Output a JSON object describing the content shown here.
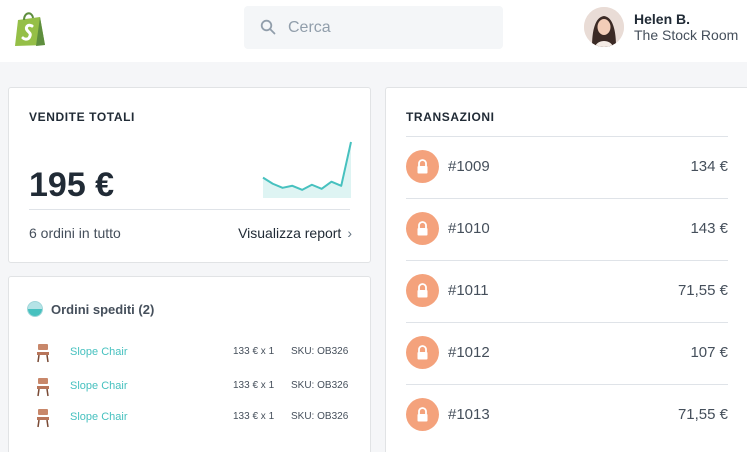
{
  "topbar": {
    "logo": "shopify-bag-logo",
    "search": {
      "placeholder": "Cerca",
      "icon": "search-icon"
    },
    "user": {
      "name": "Helen B.",
      "store": "The Stock Room"
    }
  },
  "sales_card": {
    "title": "VENDITE TOTALI",
    "total": "195 €",
    "orders_count": "6 ordini in tutto",
    "report_link": "Visualizza report",
    "sparkline_values": [
      20,
      14,
      10,
      12,
      8,
      13,
      9,
      16,
      12,
      55
    ],
    "accent_color": "#47c1bf"
  },
  "orders_card": {
    "title": "Ordini spediti (2)",
    "rows": [
      {
        "product": "Slope Chair",
        "qty": "133 € x 1",
        "sku": "SKU: OB326"
      },
      {
        "product": "Slope Chair",
        "qty": "133 € x 1",
        "sku": "SKU: OB326"
      },
      {
        "product": "Slope Chair",
        "qty": "133 € x 1",
        "sku": "SKU: OB326"
      }
    ]
  },
  "transactions_card": {
    "title": "TRANSAZIONI",
    "lock_color": "#f4a27c",
    "rows": [
      {
        "id": "#1009",
        "amount": "134 €"
      },
      {
        "id": "#1010",
        "amount": "143 €"
      },
      {
        "id": "#1011",
        "amount": "71,55 €"
      },
      {
        "id": "#1012",
        "amount": "107 €"
      },
      {
        "id": "#1013",
        "amount": "71,55 €"
      }
    ]
  }
}
